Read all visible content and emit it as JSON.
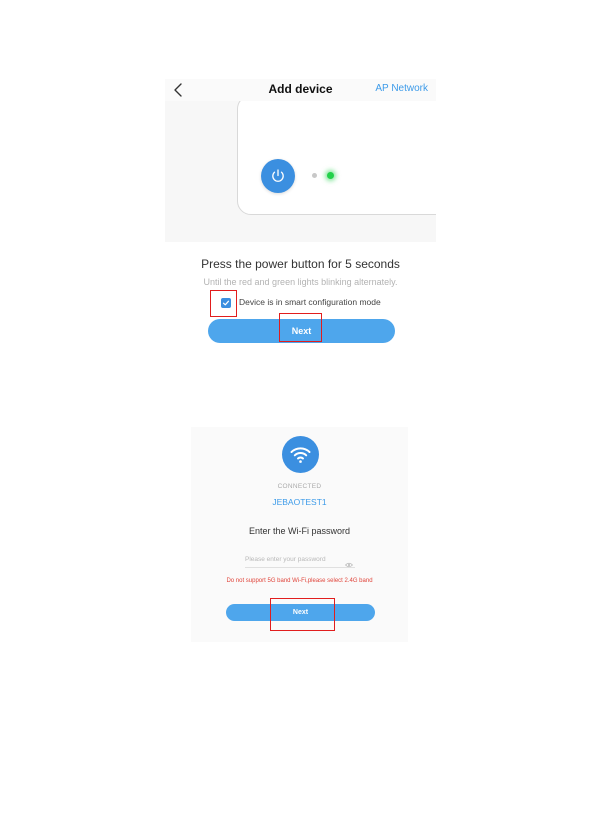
{
  "screen1": {
    "nav": {
      "back_icon": "chevron-left-icon",
      "title": "Add device",
      "right_link": "AP Network"
    },
    "illustration": {
      "power_icon": "power-icon",
      "led_colors": [
        "#c8c8c8",
        "#22d14a"
      ]
    },
    "instruction_title": "Press the power button for 5 seconds",
    "instruction_sub": "Until the red and green lights blinking alternately.",
    "checkbox": {
      "checked": true,
      "label": "Device is in smart configuration mode"
    },
    "next_button": "Next"
  },
  "screen2": {
    "wifi_icon": "wifi-icon",
    "status": "CONNECTED",
    "ssid": "JEBAOTEST1",
    "prompt": "Enter the Wi-Fi password",
    "password": {
      "value": "",
      "placeholder": "Please enter your password",
      "visibility_icon": "eye-icon"
    },
    "warning": "Do not support 5G band Wi-Fi,please select 2.4G band",
    "next_button": "Next"
  },
  "colors": {
    "accent": "#3b8fe0",
    "button": "#4ea6ec",
    "link": "#3d9be9",
    "warning": "#e0443a",
    "annotation": "#e11d1d"
  }
}
